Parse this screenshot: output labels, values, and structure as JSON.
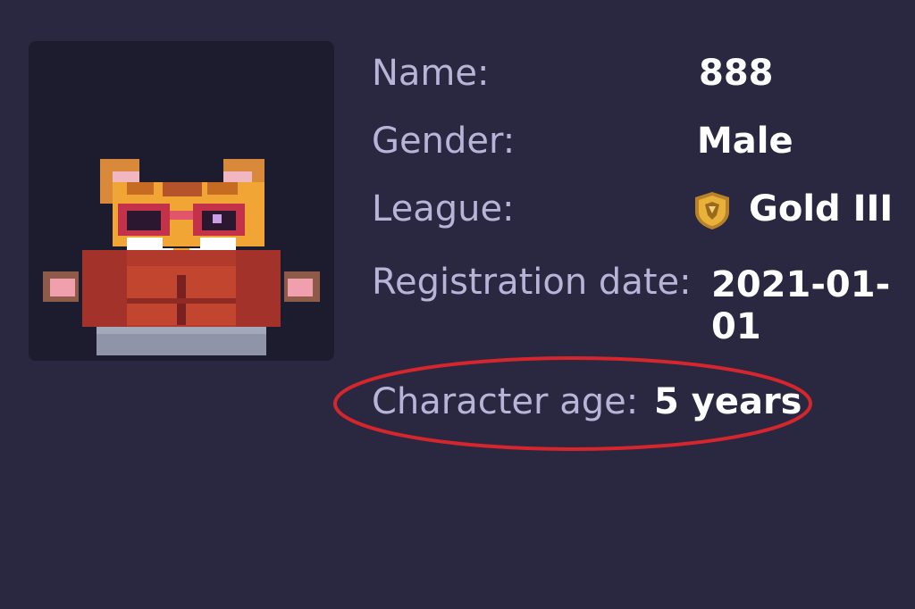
{
  "profile": {
    "name_label": "Name:",
    "name_value": "888",
    "gender_label": "Gender:",
    "gender_value": "Male",
    "league_label": "League:",
    "league_value": "Gold III",
    "league_icon": "gold-league-shield-icon",
    "registration_label": "Registration date:",
    "registration_value": "2021-01-01",
    "age_label": "Character age:",
    "age_value": "5 years"
  },
  "avatar": {
    "icon": "pixel-cat-character-avatar"
  },
  "colors": {
    "background": "#292840",
    "avatar_panel": "#1d1c2e",
    "label_text": "#b9b3d8",
    "value_text": "#ffffff",
    "highlight_circle": "#d4262c",
    "gold": "#e8b13a"
  }
}
